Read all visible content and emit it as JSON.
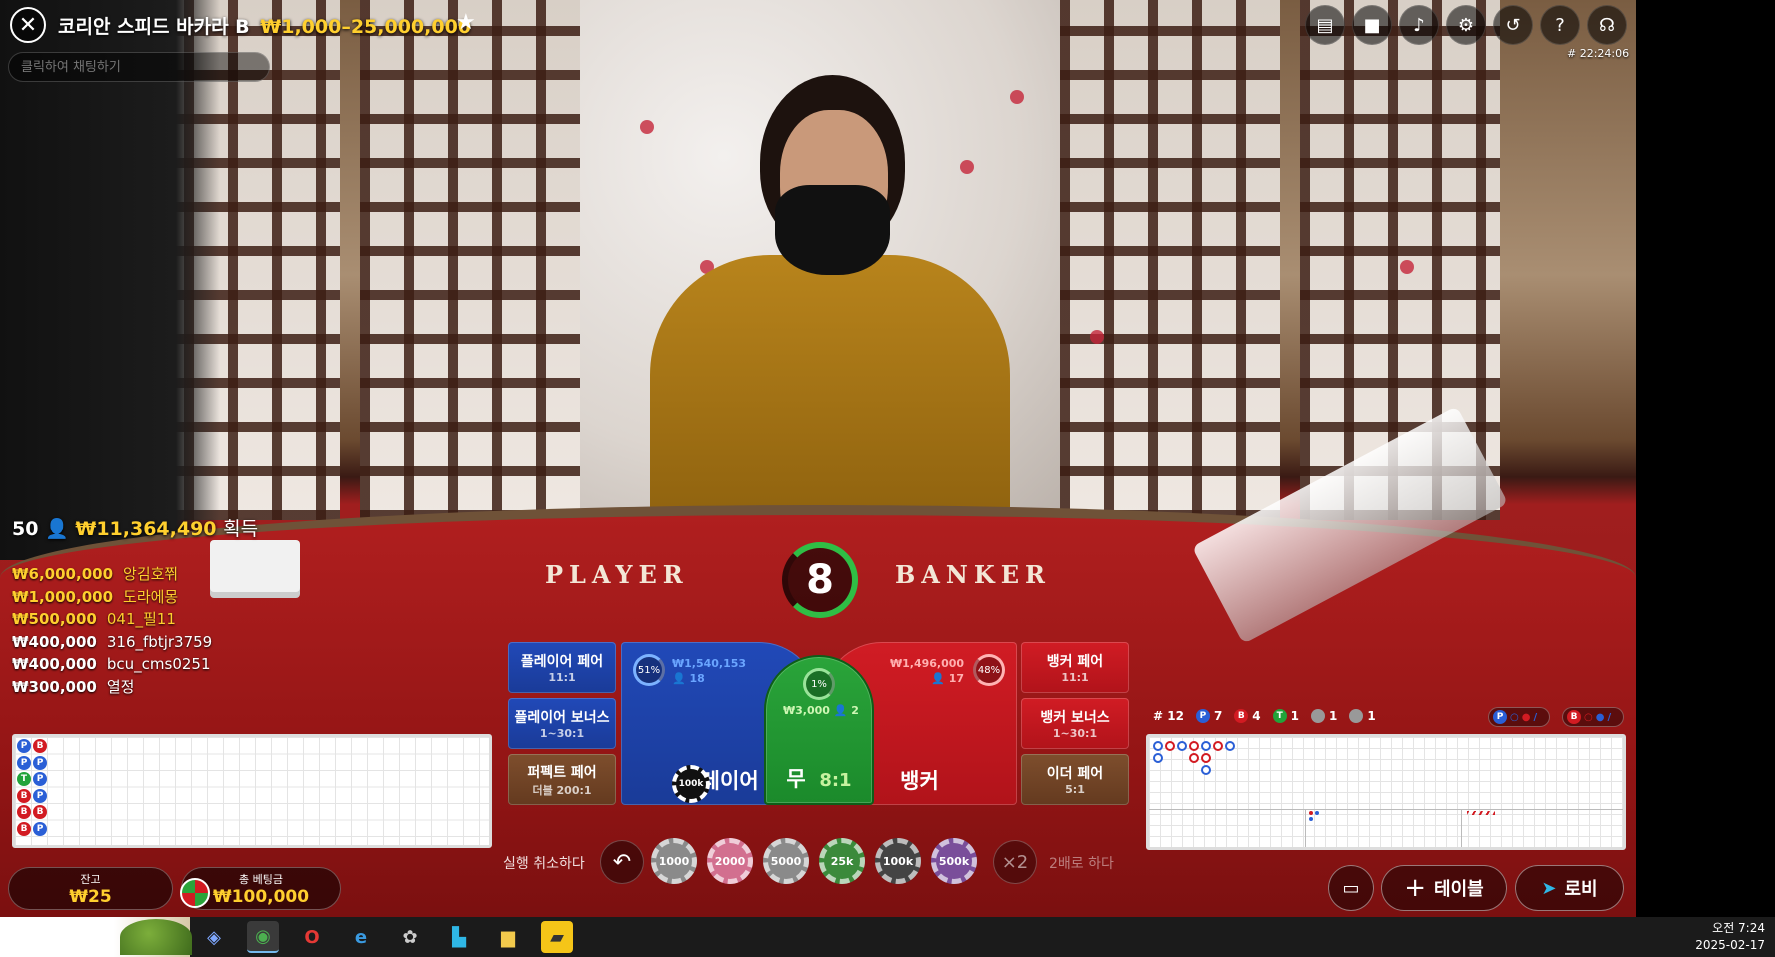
{
  "header": {
    "title": "코리안 스피드 바카라 B",
    "limits": "₩1,000–25,000,000",
    "chat_placeholder": "클릭하여 채팅하기",
    "game_id": "# 22:24:06"
  },
  "top_icons": [
    "chat-icon",
    "video-icon",
    "sound-icon",
    "settings-icon",
    "history-icon",
    "help-icon",
    "headset-icon"
  ],
  "felt": {
    "player": "PLAYER",
    "banker": "BANKER"
  },
  "countdown": "8",
  "winners": {
    "count": "50",
    "total": "₩11,364,490",
    "label": "획득",
    "list": [
      {
        "amount": "₩6,000,000",
        "name": "앙김호쮜",
        "gold": true
      },
      {
        "amount": "₩1,000,000",
        "name": "도라에몽",
        "gold": true
      },
      {
        "amount": "₩500,000",
        "name": "041_필11",
        "gold": true
      },
      {
        "amount": "₩400,000",
        "name": "316_fbtjr3759",
        "gold": false
      },
      {
        "amount": "₩400,000",
        "name": "bcu_cms0251",
        "gold": false
      },
      {
        "amount": "₩300,000",
        "name": "열정",
        "gold": false
      }
    ]
  },
  "bets": {
    "player_pair": {
      "name": "플레이어 페어",
      "odds": "11:1"
    },
    "player_bonus": {
      "name": "플레이어 보너스",
      "odds": "1~30:1"
    },
    "perfect_pair": {
      "name": "퍼펙트 페어",
      "odds": "더블 200:1"
    },
    "banker_pair": {
      "name": "뱅커 페어",
      "odds": "11:1"
    },
    "banker_bonus": {
      "name": "뱅커 보너스",
      "odds": "1~30:1"
    },
    "either_pair": {
      "name": "이더 페어",
      "odds": "5:1"
    },
    "player": {
      "label": "플레이어",
      "pct": "51%",
      "amount": "₩1,540,153",
      "players": "18",
      "chip": "100k"
    },
    "tie": {
      "label": "무",
      "odds": "8:1",
      "pct": "1%",
      "amount": "₩3,000",
      "players": "2"
    },
    "banker": {
      "label": "뱅커",
      "pct": "48%",
      "amount": "₩1,496,000",
      "players": "17"
    }
  },
  "controls": {
    "undo_label": "실행 취소하다",
    "double_label": "2배로 하다",
    "double_btn": "×2",
    "chips": [
      {
        "label": "1000",
        "color": "#8a8a8a"
      },
      {
        "label": "2000",
        "color": "#d26f8f"
      },
      {
        "label": "5000",
        "color": "#8a8a8a"
      },
      {
        "label": "25k",
        "color": "#3b8a3b"
      },
      {
        "label": "100k",
        "color": "#444444"
      },
      {
        "label": "500k",
        "color": "#7a4e9a"
      }
    ]
  },
  "balance": {
    "label": "잔고",
    "value": "₩25"
  },
  "total_bet": {
    "label": "총 베팅금",
    "value": "₩100,000"
  },
  "stats": {
    "round": "# 12",
    "player": "7",
    "banker": "4",
    "tie": "1",
    "player_pair": "1",
    "banker_pair": "1"
  },
  "bead_road": [
    [
      "P",
      "B"
    ],
    [
      "P",
      "P"
    ],
    [
      "T",
      "P"
    ],
    [
      "B",
      "P"
    ],
    [
      "B",
      "B"
    ],
    [
      "B",
      "P"
    ]
  ],
  "buttons": {
    "tables": "테이블",
    "lobby": "로비"
  },
  "colors": {
    "player": "#2a5fd6",
    "banker": "#d21b22",
    "tie": "#22a33a",
    "gold": "#ffcf2e"
  },
  "taskbar": {
    "icons": [
      "copilot-icon",
      "chrome-icon",
      "opera-icon",
      "edge-icon",
      "app-icon",
      "app2-icon",
      "folder-icon",
      "sticky-notes-icon"
    ],
    "time": "오전 7:24",
    "date": "2025-02-17"
  }
}
